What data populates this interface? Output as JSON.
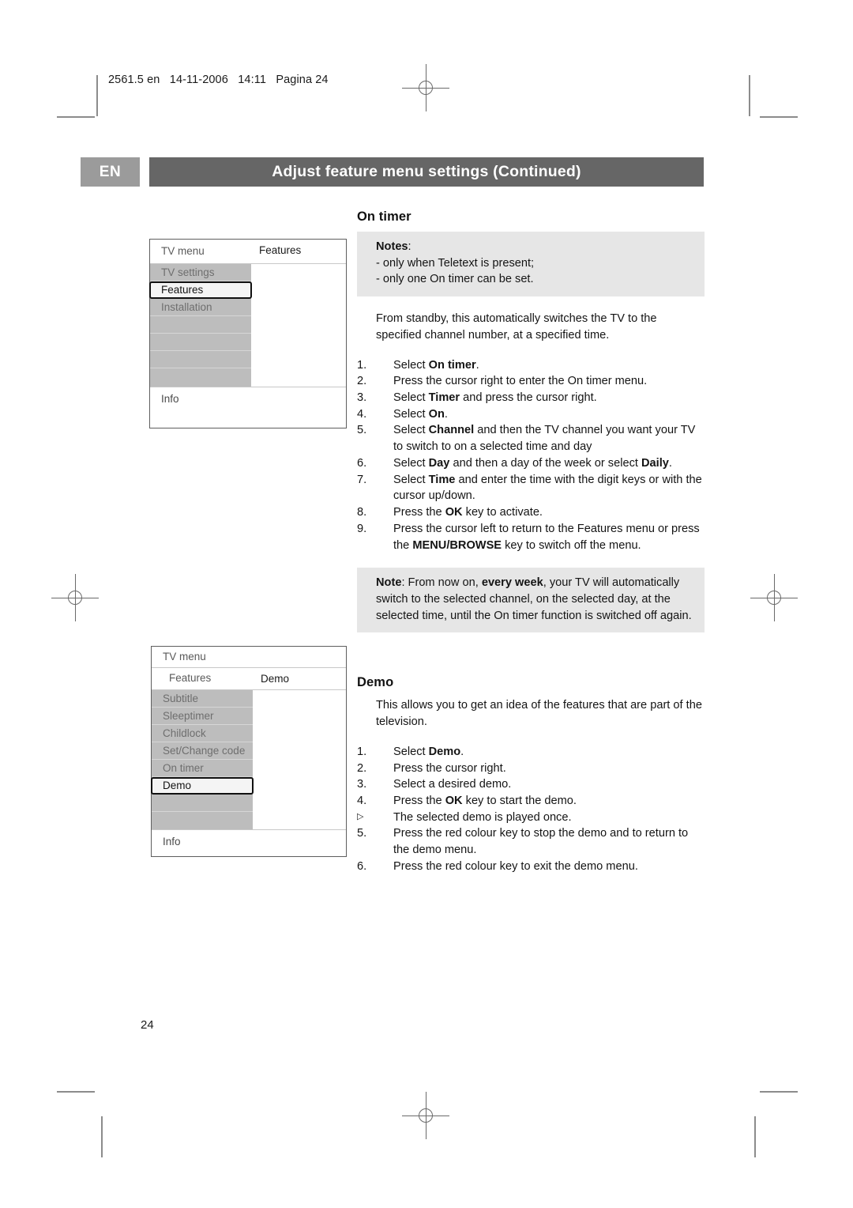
{
  "document_meta": "2561.5 en   14-11-2006   14:11   Pagina 24",
  "page_number": "24",
  "header": {
    "language_badge": "EN",
    "title": "Adjust feature menu settings  (Continued)",
    "badge_color": "#9b9b9b",
    "bar_color": "#666666"
  },
  "menu_ontimer": {
    "title_left": "TV menu",
    "title_right": "Features",
    "info_label": "Info",
    "items": [
      {
        "label": "TV settings",
        "selected": false
      },
      {
        "label": "Features",
        "selected": true
      },
      {
        "label": "Installation",
        "selected": false
      },
      {
        "label": "",
        "selected": false
      },
      {
        "label": "",
        "selected": false
      },
      {
        "label": "",
        "selected": false
      },
      {
        "label": "",
        "selected": false
      }
    ]
  },
  "menu_demo": {
    "title_left": "TV menu",
    "sub_left": "Features",
    "sub_right": "Demo",
    "info_label": "Info",
    "items": [
      {
        "label": "Subtitle",
        "selected": false
      },
      {
        "label": "Sleeptimer",
        "selected": false
      },
      {
        "label": "Childlock",
        "selected": false
      },
      {
        "label": "Set/Change code",
        "selected": false
      },
      {
        "label": "On timer",
        "selected": false
      },
      {
        "label": "Demo",
        "selected": true
      },
      {
        "label": "",
        "selected": false
      },
      {
        "label": "",
        "selected": false
      }
    ]
  },
  "ontimer": {
    "heading": "On timer",
    "notes_title": "Notes",
    "notes_colon": ":",
    "notes_lines": [
      "- only when Teletext is present;",
      "- only one On timer can be set."
    ],
    "intro": "From standby, this automatically switches the TV to the specified channel number, at a specified time.",
    "steps": [
      {
        "num": "1.",
        "html": "Select <b>On timer</b>."
      },
      {
        "num": "2.",
        "html": "Press the cursor right to enter the On timer menu."
      },
      {
        "num": "3.",
        "html": "Select <b>Timer</b> and press the cursor right."
      },
      {
        "num": "4.",
        "html": "Select <b>On</b>."
      },
      {
        "num": "5.",
        "html": "Select <b>Channel</b> and then the TV channel you want your TV to switch to on a selected time and day"
      },
      {
        "num": "6.",
        "html": "Select <b>Day</b> and then a day of the week or select <b>Daily</b>."
      },
      {
        "num": "7.",
        "html": "Select <b>Time</b> and enter the time with the digit keys or with the cursor up/down."
      },
      {
        "num": "8.",
        "html": "Press the <b>OK</b> key to activate."
      },
      {
        "num": "9.",
        "html": "Press the cursor left to return to the Features menu or press the <b>MENU/BROWSE</b> key to switch off the menu."
      }
    ],
    "note_box_html": "<b>Note</b>: From now on, <b>every week</b>, your TV will automatically switch to the selected channel, on the selected day, at the selected time, until the On timer function is switched off again."
  },
  "demo": {
    "heading": "Demo",
    "intro": "This allows you to get an idea of the features that are part of the television.",
    "steps": [
      {
        "num": "1.",
        "html": "Select <b>Demo</b>."
      },
      {
        "num": "2.",
        "html": "Press the cursor right."
      },
      {
        "num": "3.",
        "html": "Select a desired demo."
      },
      {
        "num": "4.",
        "html": "Press the <b>OK</b> key to start the demo."
      },
      {
        "num": "▷",
        "html": "The selected demo is played once.",
        "bullet": true
      },
      {
        "num": "5.",
        "html": "Press the red colour key to stop the demo and to return to the demo menu."
      },
      {
        "num": "6.",
        "html": "Press the red colour key to exit the demo menu."
      }
    ]
  }
}
